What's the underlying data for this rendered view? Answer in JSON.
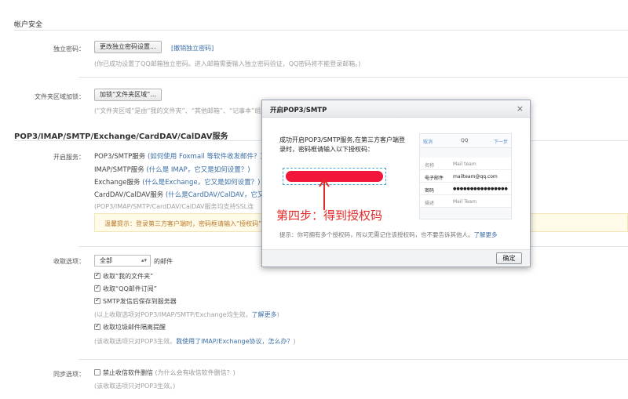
{
  "account_security": {
    "title": "帐户安全",
    "independent_password": {
      "label": "独立密码：",
      "button": "更改独立密码设置...",
      "cancel_link": "[撤销独立密码]",
      "hint": "(你已成功设置了QQ邮箱独立密码。进入邮箱需要输入独立密码验证，QQ密码将不能登录邮箱。)"
    },
    "folder_lock": {
      "label": "文件夹区域加锁：",
      "button": "加锁“文件夹区域”...",
      "hint": "(“文件夹区域”是由“我的文件夹”、“其他邮箱”、“记事本”组成"
    }
  },
  "protocols": {
    "title": "POP3/IMAP/SMTP/Exchange/CardDAV/CalDAV服务",
    "label": "开启服务：",
    "services": [
      {
        "name": "POP3/SMTP服务",
        "extra": "(如何使用 Foxmail 等软件收发邮件？)"
      },
      {
        "name": "IMAP/SMTP服务",
        "extra": "(什么是 IMAP，它又是如何设置？)"
      },
      {
        "name": "Exchange服务",
        "extra": "(什么是Exchange，它又是如何设置？)"
      },
      {
        "name": "CardDAV/CalDAV服务",
        "extra": "(什么是CardDAV/CalDAV，它又是"
      }
    ],
    "support_note": "(POP3/IMAP/SMTP/CardDAV/CalDAV服务均支持SSL连",
    "tip": "温馨提示：登录第三方客户端时，密码框请输入“授权码”"
  },
  "receive": {
    "label": "收取选项：",
    "select_value": "全部",
    "select_suffix": "的邮件",
    "options": [
      {
        "label": "收取“我的文件夹”",
        "checked": true
      },
      {
        "label": "收取“QQ邮件订阅”",
        "checked": true
      },
      {
        "label": "SMTP发信后保存到服务器",
        "checked": true
      }
    ],
    "note1": "(以上收取选项对POP3/IMAP/SMTP/Exchange均生效。",
    "note1_link": "了解更多",
    "note1_end": ")",
    "spam_option": {
      "label": "收取垃圾邮件隔离提醒",
      "checked": true
    },
    "note2": "(该收取选项只对POP3生效。",
    "note2_link": "我使用了IMAP/Exchange协议，怎么办？",
    "note2_end": ")"
  },
  "sync": {
    "label": "同步选项：",
    "option": {
      "label": "禁止收信软件删信",
      "checked": false
    },
    "option_extra": "(为什么会有收信软件删信？)",
    "note": "(该收取选项只对POP3生效。)"
  },
  "dialog": {
    "title": "开启POP3/SMTP",
    "close": "×",
    "message": "成功开启POP3/SMTP服务,在第三方客户端登录时，密码框请输入以下授权码：",
    "annotation": "第四步：得到授权码",
    "tip": "提示：你可拥有多个授权码，所以无需记住该授权码，也不要告诉其他人。",
    "tip_link": "了解更多",
    "ok_button": "确定",
    "phone": {
      "left": "取消",
      "center": "QQ",
      "right": "下一步",
      "rows": [
        {
          "key": "名称",
          "value": "Mail team"
        },
        {
          "key": "电子邮件",
          "value": "mailteam@qq.com"
        },
        {
          "key": "密码",
          "value": "●●●●●●●●●●●●●●●●"
        },
        {
          "key": "描述",
          "value": "Mail Team"
        }
      ]
    }
  },
  "colors": {
    "accent": "#3a6ea5",
    "annotation": "#e12a2a",
    "redaction": "#f2163b"
  }
}
